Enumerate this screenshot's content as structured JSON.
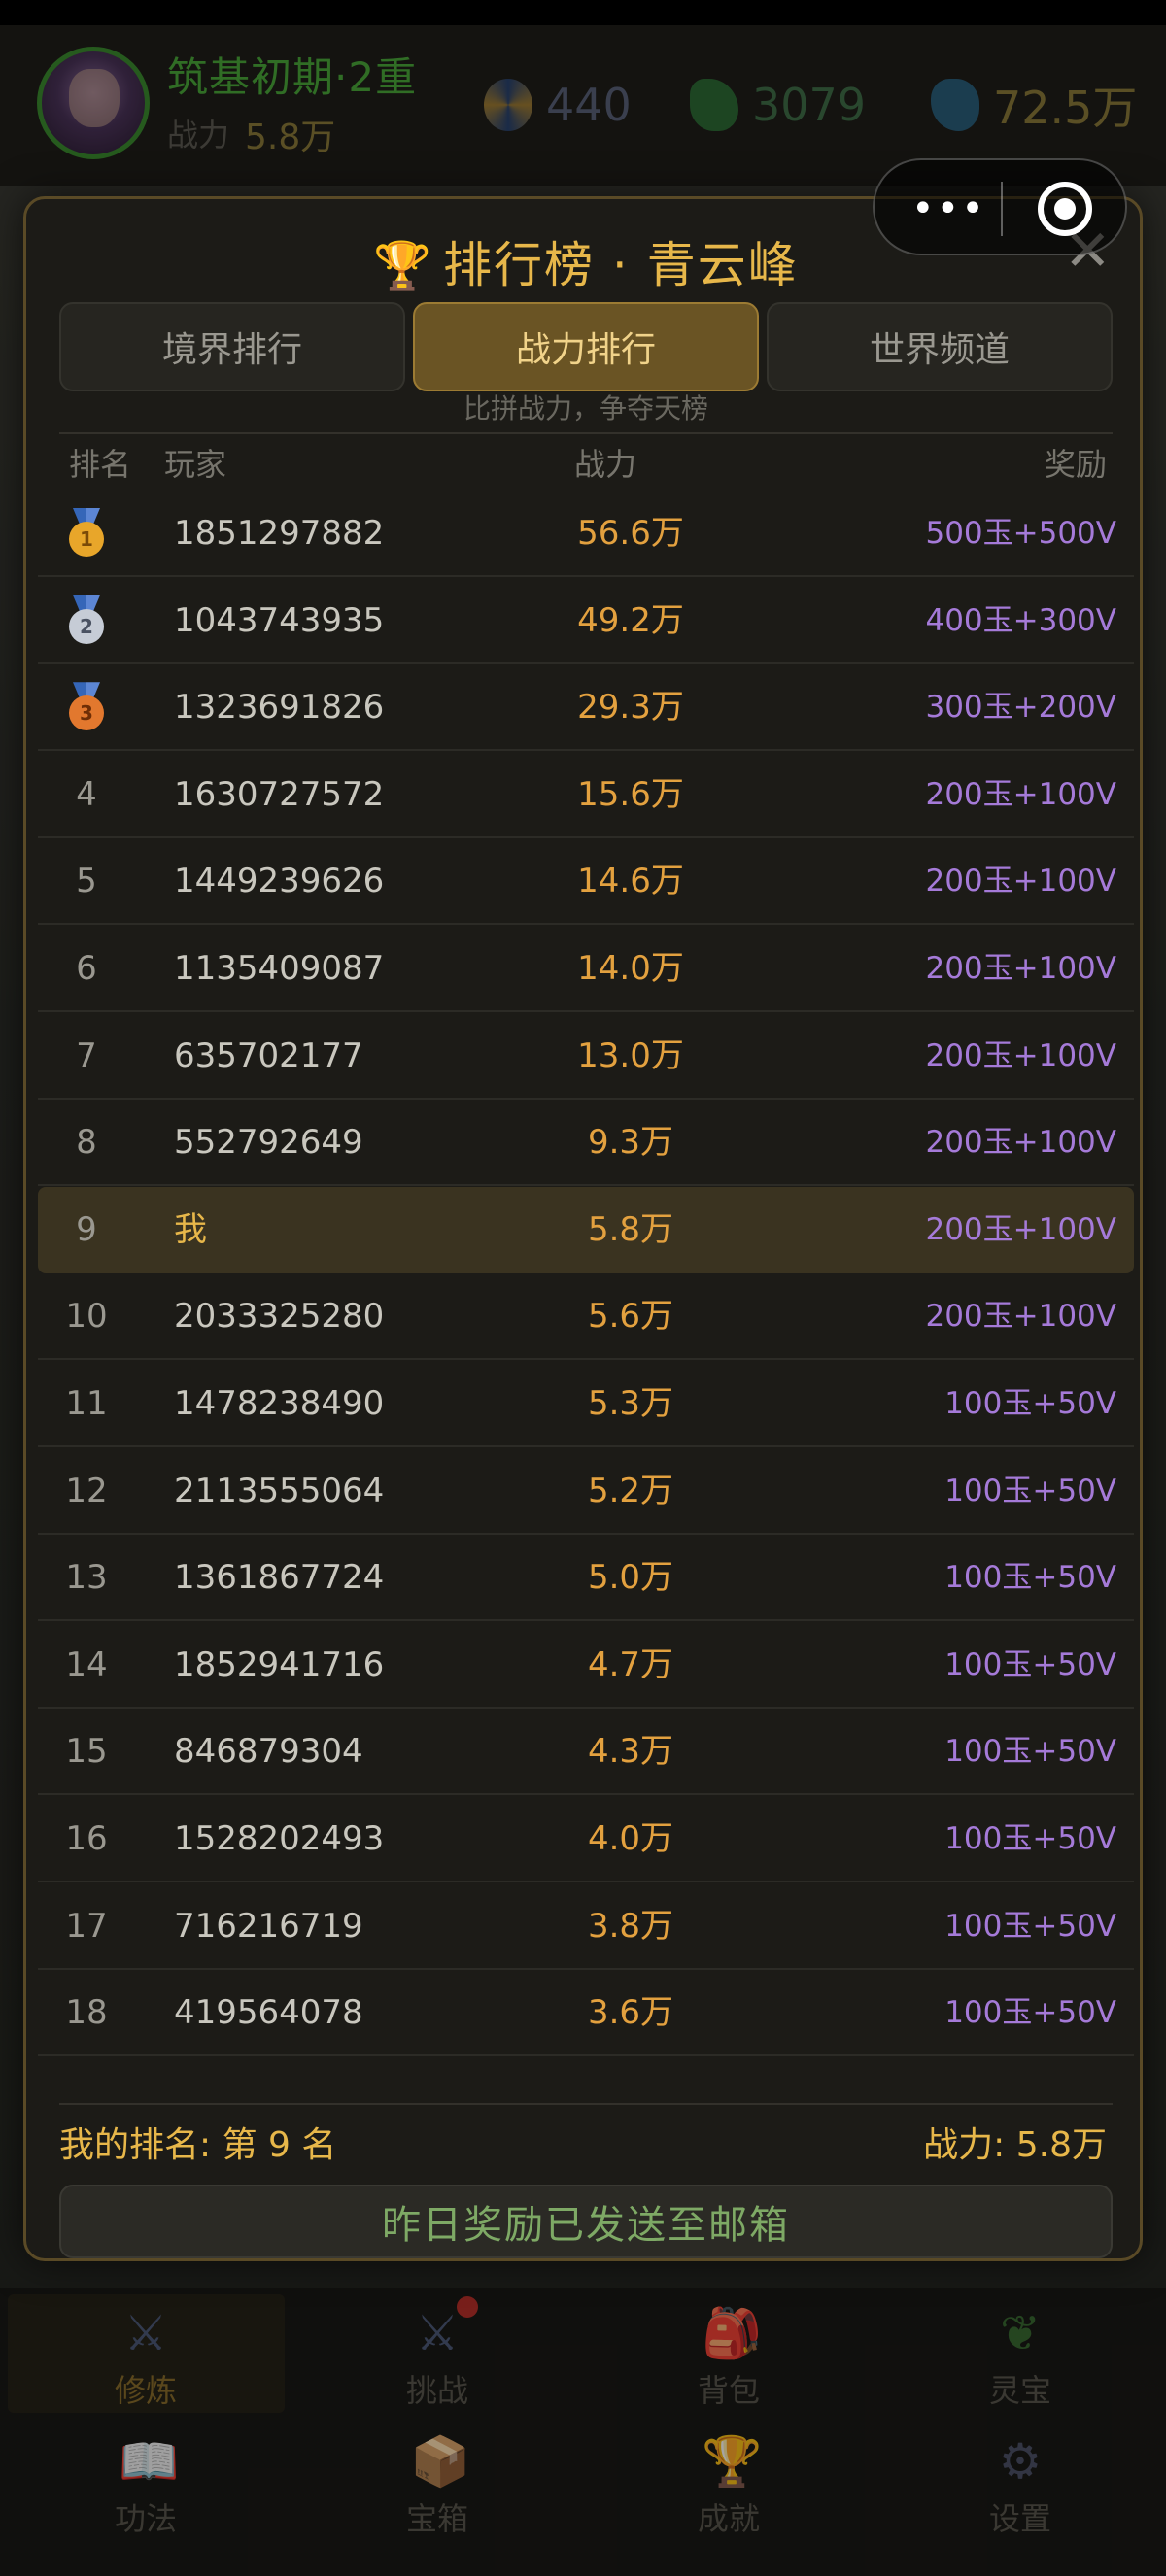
{
  "header": {
    "realm": "筑基初期·2重",
    "power_label": "战力",
    "power_value": "5.8万",
    "resources": [
      {
        "icon": "spirit-swirl-icon",
        "value": "440"
      },
      {
        "icon": "dragon-icon",
        "value": "3079"
      },
      {
        "icon": "gem-icon",
        "value": "72.5万"
      }
    ]
  },
  "capsule": {
    "more": "•••"
  },
  "modal": {
    "title": "排行榜 · 青云峰",
    "close": "✕",
    "tabs": [
      {
        "label": "境界排行",
        "active": false
      },
      {
        "label": "战力排行",
        "active": true
      },
      {
        "label": "世界频道",
        "active": false
      }
    ],
    "subtitle": "比拼战力，争夺天榜",
    "columns": {
      "rank": "排名",
      "player": "玩家",
      "power": "战力",
      "reward": "奖励"
    },
    "rows": [
      {
        "rank": "1",
        "medal": "gold",
        "name": "1851297882",
        "power": "56.6万",
        "reward": "500玉+500V"
      },
      {
        "rank": "2",
        "medal": "silver",
        "name": "1043743935",
        "power": "49.2万",
        "reward": "400玉+300V"
      },
      {
        "rank": "3",
        "medal": "bronze",
        "name": "1323691826",
        "power": "29.3万",
        "reward": "300玉+200V"
      },
      {
        "rank": "4",
        "name": "1630727572",
        "power": "15.6万",
        "reward": "200玉+100V"
      },
      {
        "rank": "5",
        "name": "1449239626",
        "power": "14.6万",
        "reward": "200玉+100V"
      },
      {
        "rank": "6",
        "name": "1135409087",
        "power": "14.0万",
        "reward": "200玉+100V"
      },
      {
        "rank": "7",
        "name": "635702177",
        "power": "13.0万",
        "reward": "200玉+100V"
      },
      {
        "rank": "8",
        "name": "552792649",
        "power": "9.3万",
        "reward": "200玉+100V"
      },
      {
        "rank": "9",
        "name": "我",
        "power": "5.8万",
        "reward": "200玉+100V",
        "me": true
      },
      {
        "rank": "10",
        "name": "2033325280",
        "power": "5.6万",
        "reward": "200玉+100V"
      },
      {
        "rank": "11",
        "name": "1478238490",
        "power": "5.3万",
        "reward": "100玉+50V"
      },
      {
        "rank": "12",
        "name": "2113555064",
        "power": "5.2万",
        "reward": "100玉+50V"
      },
      {
        "rank": "13",
        "name": "1361867724",
        "power": "5.0万",
        "reward": "100玉+50V"
      },
      {
        "rank": "14",
        "name": "1852941716",
        "power": "4.7万",
        "reward": "100玉+50V"
      },
      {
        "rank": "15",
        "name": "846879304",
        "power": "4.3万",
        "reward": "100玉+50V"
      },
      {
        "rank": "16",
        "name": "1528202493",
        "power": "4.0万",
        "reward": "100玉+50V"
      },
      {
        "rank": "17",
        "name": "716216719",
        "power": "3.8万",
        "reward": "100玉+50V"
      },
      {
        "rank": "18",
        "name": "419564078",
        "power": "3.6万",
        "reward": "100玉+50V"
      }
    ],
    "my_rank": "我的排名: 第 9 名",
    "my_power": "战力: 5.8万",
    "reward_button": "昨日奖励已发送至邮箱"
  },
  "bottom_nav": [
    {
      "icon": "crossed-swords-icon",
      "glyph": "⚔",
      "label": "修炼",
      "active": true
    },
    {
      "icon": "challenge-swords-icon",
      "glyph": "⚔",
      "label": "挑战",
      "badge": true
    },
    {
      "icon": "backpack-icon",
      "glyph": "🎒",
      "label": "背包"
    },
    {
      "icon": "sprout-icon",
      "glyph": "❦",
      "label": "灵宝"
    },
    {
      "icon": "book-icon",
      "glyph": "📖",
      "label": "功法"
    },
    {
      "icon": "treasure-box-icon",
      "glyph": "📦",
      "label": "宝箱"
    },
    {
      "icon": "trophy-icon",
      "glyph": "🏆",
      "label": "成就"
    },
    {
      "icon": "gear-icon",
      "glyph": "⚙",
      "label": "设置"
    }
  ],
  "colors": {
    "accent_gold": "#e7b74a",
    "power_orange": "#e3a13f",
    "reward_purple": "#a57ad8",
    "button_green": "#7ea965"
  }
}
